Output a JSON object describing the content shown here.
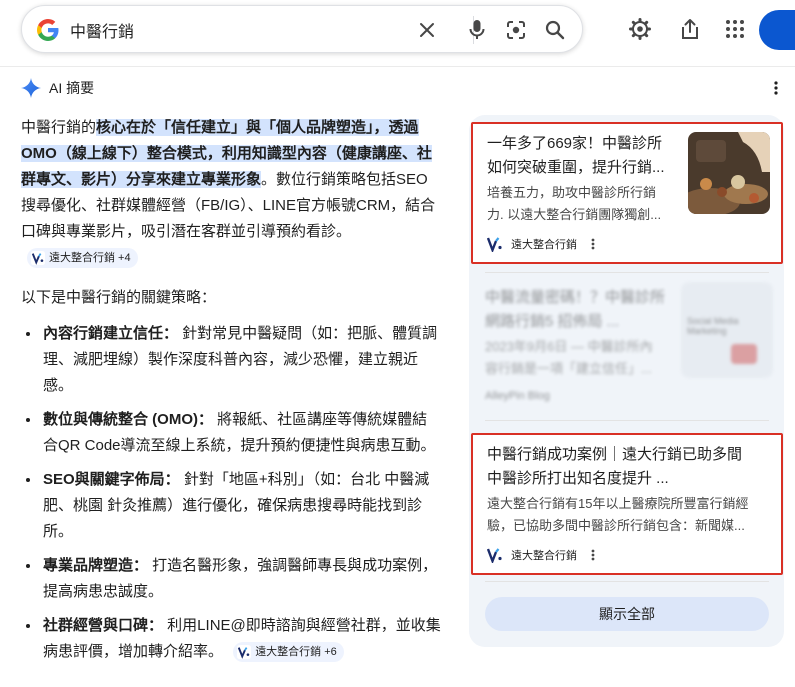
{
  "search": {
    "query": "中醫行銷"
  },
  "ai_overview": {
    "title": "AI 摘要",
    "intro": {
      "part1": "中醫行銷的",
      "highlight": "核心在於「信任建立」與「個人品牌塑造」，透過OMO（線上線下）整合模式，利用知識型內容（健康講座、社群專文、影片）分享來建立專業形象",
      "part2": "。數位行銷策略包括SEO搜尋優化、社群媒體經營（FB/IG）、LINE官方帳號CRM，結合口碑與專業影片，吸引潛在客群並引導預約看診。",
      "chip": "遠大整合行銷 +4"
    },
    "strategies_intro": "以下是中醫行銷的關鍵策略：",
    "bullets": [
      {
        "heading": "內容行銷建立信任：",
        "text": " 針對常見中醫疑問（如：把脈、體質調理、減肥埋線）製作深度科普內容，減少恐懼，建立親近感。"
      },
      {
        "heading": "數位與傳統整合 (OMO)：",
        "text": " 將報紙、社區講座等傳統媒體結合QR Code導流至線上系統，提升預約便捷性與病患互動。"
      },
      {
        "heading": "SEO與關鍵字佈局：",
        "text": " 針對「地區+科別」（如：台北 中醫減肥、桃園 針灸推薦）進行優化，確保病患搜尋時能找到診所。"
      },
      {
        "heading": "專業品牌塑造：",
        "text": " 打造名醫形象，強調醫師專長與成功案例，提高病患忠誠度。"
      },
      {
        "heading": "社群經營與口碑：",
        "text": " 利用LINE@即時諮詢與經營社群，並收集病患評價，增加轉介紹率。",
        "chip": "遠大整合行銷 +6"
      }
    ]
  },
  "sources": {
    "cards": [
      {
        "title_line1": "一年多了669家！中醫診所",
        "title_line2": "如何突破重圍，提升行銷...",
        "snippet_line1": "培養五力，助攻中醫診所行銷",
        "snippet_line2": "力. 以遠大整合行銷團隊獨創...",
        "source": "遠大整合行銷"
      },
      {
        "title_line1": "中醫流量密碼！？中醫診所",
        "title_line2": "網路行銷5 招佈局 ...",
        "snippet_line1": "2023年9月6日 — 中醫診所內",
        "snippet_line2": "容行銷是一項「建立信任」...",
        "source": "AlleyPin Blog",
        "thumb_text": "Social Media Marketing"
      },
      {
        "title_line1": "中醫行銷成功案例｜遠大行銷已助多間",
        "title_line2": "中醫診所打出知名度提升 ...",
        "snippet_line1": "遠大整合行銷有15年以上醫療院所豐富行銷經",
        "snippet_line2": "驗，已協助多間中醫診所行銷包含：新聞媒...",
        "source": "遠大整合行銷"
      }
    ],
    "show_all": "顯示全部"
  },
  "colors": {
    "highlight": "#d3e3fd",
    "accent_blue": "#0b57d0",
    "red_outline": "#d93025",
    "panel_bg": "#f0f4f9"
  }
}
